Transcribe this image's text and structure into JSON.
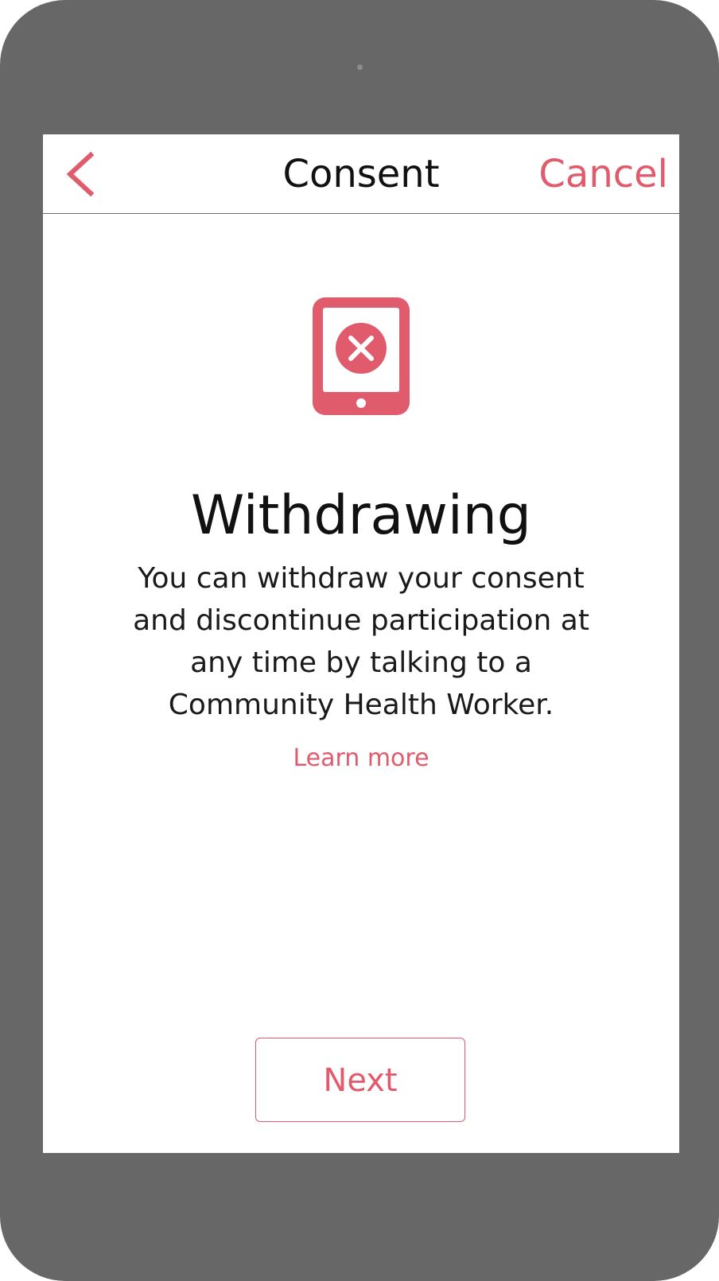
{
  "navbar": {
    "title": "Consent",
    "cancel_label": "Cancel",
    "back_icon": "chevron-left-icon"
  },
  "content": {
    "icon": "tablet-error-icon",
    "heading": "Withdrawing",
    "body": "You can withdraw your consent and discontinue participation at any time by talking to a Community Health Worker.",
    "learn_more_label": "Learn more"
  },
  "footer": {
    "next_label": "Next"
  },
  "colors": {
    "accent": "#e05b6b",
    "device_frame": "#676767",
    "text": "#111111"
  }
}
